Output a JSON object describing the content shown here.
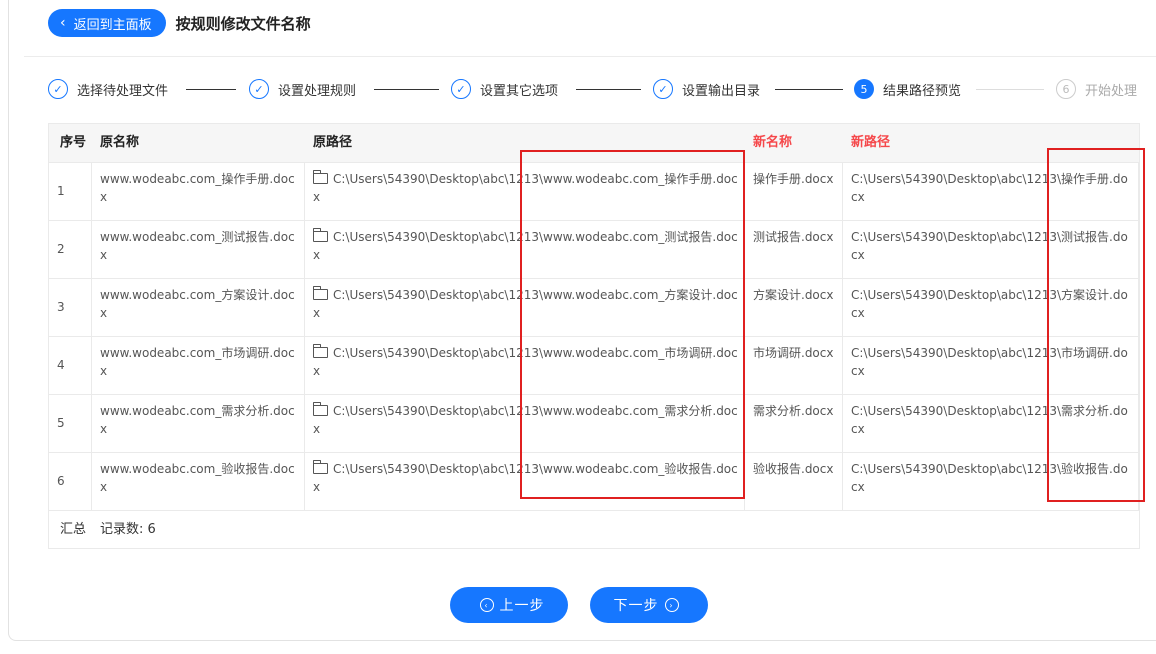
{
  "header": {
    "back_label": "返回到主面板",
    "title": "按规则修改文件名称"
  },
  "steps": [
    {
      "label": "选择待处理文件",
      "state": "done"
    },
    {
      "label": "设置处理规则",
      "state": "done"
    },
    {
      "label": "设置其它选项",
      "state": "done"
    },
    {
      "label": "设置输出目录",
      "state": "done"
    },
    {
      "label": "结果路径预览",
      "number": "5",
      "state": "active"
    },
    {
      "label": "开始处理",
      "number": "6",
      "state": "future"
    }
  ],
  "table": {
    "headers": {
      "no": "序号",
      "orig_name": "原名称",
      "orig_path": "原路径",
      "new_name": "新名称",
      "new_path": "新路径"
    },
    "rows": [
      {
        "no": "1",
        "orig_name": "www.wodeabc.com_操作手册.docx",
        "orig_path": "C:\\Users\\54390\\Desktop\\abc\\1213\\www.wodeabc.com_操作手册.docx",
        "new_name": "操作手册.docx",
        "new_path": "C:\\Users\\54390\\Desktop\\abc\\1213\\操作手册.docx"
      },
      {
        "no": "2",
        "orig_name": "www.wodeabc.com_测试报告.docx",
        "orig_path": "C:\\Users\\54390\\Desktop\\abc\\1213\\www.wodeabc.com_测试报告.docx",
        "new_name": "测试报告.docx",
        "new_path": "C:\\Users\\54390\\Desktop\\abc\\1213\\测试报告.docx"
      },
      {
        "no": "3",
        "orig_name": "www.wodeabc.com_方案设计.docx",
        "orig_path": "C:\\Users\\54390\\Desktop\\abc\\1213\\www.wodeabc.com_方案设计.docx",
        "new_name": "方案设计.docx",
        "new_path": "C:\\Users\\54390\\Desktop\\abc\\1213\\方案设计.docx"
      },
      {
        "no": "4",
        "orig_name": "www.wodeabc.com_市场调研.docx",
        "orig_path": "C:\\Users\\54390\\Desktop\\abc\\1213\\www.wodeabc.com_市场调研.docx",
        "new_name": "市场调研.docx",
        "new_path": "C:\\Users\\54390\\Desktop\\abc\\1213\\市场调研.docx"
      },
      {
        "no": "5",
        "orig_name": "www.wodeabc.com_需求分析.docx",
        "orig_path": "C:\\Users\\54390\\Desktop\\abc\\1213\\www.wodeabc.com_需求分析.docx",
        "new_name": "需求分析.docx",
        "new_path": "C:\\Users\\54390\\Desktop\\abc\\1213\\需求分析.docx"
      },
      {
        "no": "6",
        "orig_name": "www.wodeabc.com_验收报告.docx",
        "orig_path": "C:\\Users\\54390\\Desktop\\abc\\1213\\www.wodeabc.com_验收报告.docx",
        "new_name": "验收报告.docx",
        "new_path": "C:\\Users\\54390\\Desktop\\abc\\1213\\验收报告.docx"
      }
    ],
    "summary": {
      "label": "汇总",
      "count_text": "记录数: 6"
    }
  },
  "nav": {
    "prev_label": "上一步",
    "next_label": "下一步"
  },
  "colors": {
    "accent": "#1677ff",
    "highlight": "#e02020",
    "new_header": "#f5484b"
  },
  "icons": [
    "chevron-left-icon",
    "check-circle-icon",
    "folder-icon",
    "circle-chevron-left-icon",
    "circle-chevron-right-icon"
  ]
}
